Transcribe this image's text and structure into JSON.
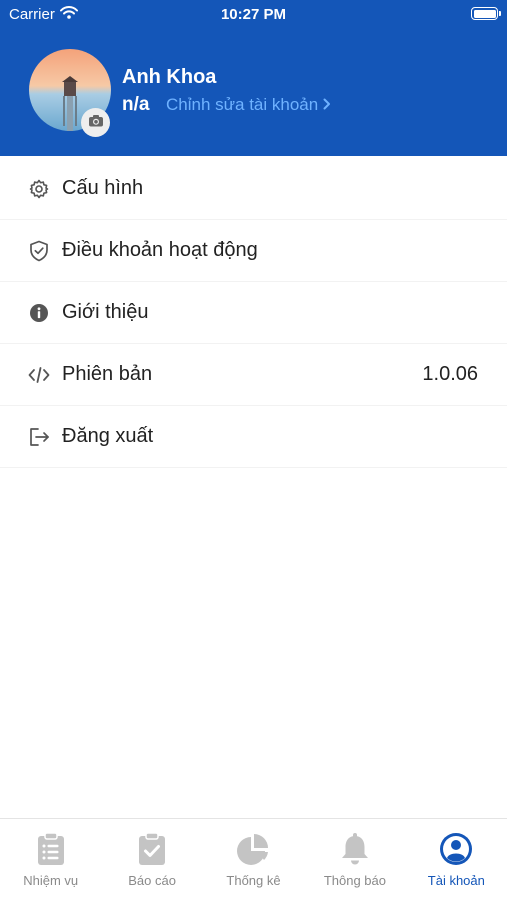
{
  "status_bar": {
    "carrier": "Carrier",
    "time": "10:27 PM"
  },
  "profile": {
    "name": "Anh Khoa",
    "subtitle": "n/a",
    "edit_label": "Chỉnh sửa tài khoản"
  },
  "menu": [
    {
      "label": "Cấu hình",
      "icon": "gear-icon"
    },
    {
      "label": "Điều khoản hoạt động",
      "icon": "shield-check-icon"
    },
    {
      "label": "Giới thiệu",
      "icon": "info-icon"
    },
    {
      "label": "Phiên bản",
      "value": "1.0.06",
      "icon": "code-icon"
    },
    {
      "label": "Đăng xuất",
      "icon": "logout-icon"
    }
  ],
  "tabs": [
    {
      "label": "Nhiệm vụ",
      "icon": "clipboard-list-icon"
    },
    {
      "label": "Báo cáo",
      "icon": "clipboard-check-icon"
    },
    {
      "label": "Thống kê",
      "icon": "pie-chart-icon"
    },
    {
      "label": "Thông báo",
      "icon": "bell-icon"
    },
    {
      "label": "Tài khoản",
      "icon": "user-circle-icon",
      "active": true
    }
  ],
  "colors": {
    "primary": "#1456b8",
    "link": "#6fb2ff",
    "inactive_tab": "#c4c4c4"
  }
}
